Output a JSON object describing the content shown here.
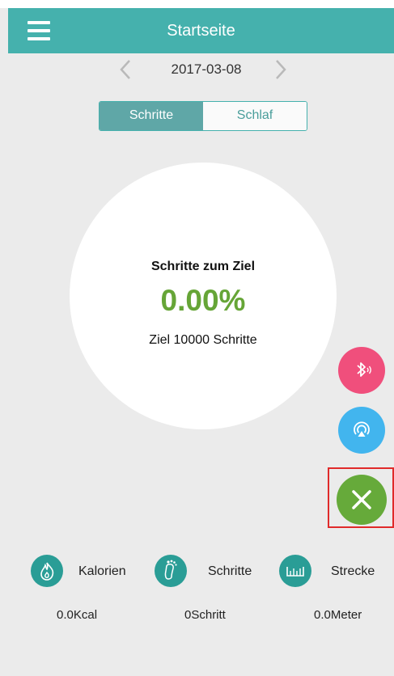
{
  "header": {
    "title": "Startseite",
    "menu_icon": "hamburger-menu-icon"
  },
  "date_nav": {
    "date": "2017-03-08",
    "prev_icon": "chevron-left-icon",
    "next_icon": "chevron-right-icon"
  },
  "tabs": [
    {
      "label": "Schritte",
      "active": true
    },
    {
      "label": "Schlaf",
      "active": false
    }
  ],
  "progress": {
    "title": "Schritte zum Ziel",
    "percent": "0.00%",
    "goal_text": "Ziel 10000 Schritte",
    "percent_color": "#66a537"
  },
  "actions": [
    {
      "icon": "bluetooth-icon",
      "color": "#f04f7c"
    },
    {
      "icon": "sync-icon",
      "color": "#42b5ee"
    },
    {
      "icon": "close-icon",
      "color": "#66aa3a"
    }
  ],
  "stats": [
    {
      "icon": "flame-icon",
      "label": "Kalorien",
      "value": "0.0Kcal"
    },
    {
      "icon": "footprint-icon",
      "label": "Schritte",
      "value": "0Schritt"
    },
    {
      "icon": "ruler-icon",
      "label": "Strecke",
      "value": "0.0Meter"
    }
  ],
  "colors": {
    "header": "#45b1ad",
    "background": "#ebebeb",
    "stat_icon": "#2a9d96"
  }
}
